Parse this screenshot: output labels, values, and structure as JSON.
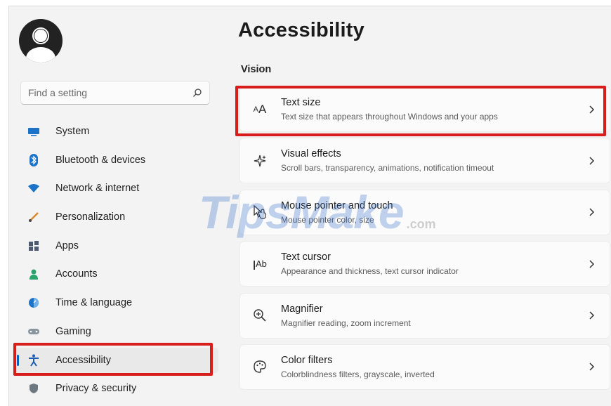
{
  "search": {
    "placeholder": "Find a setting"
  },
  "sidebar": {
    "items": [
      {
        "label": "System",
        "icon": "monitor-icon"
      },
      {
        "label": "Bluetooth & devices",
        "icon": "bluetooth-icon"
      },
      {
        "label": "Network & internet",
        "icon": "wifi-icon"
      },
      {
        "label": "Personalization",
        "icon": "brush-icon"
      },
      {
        "label": "Apps",
        "icon": "apps-icon"
      },
      {
        "label": "Accounts",
        "icon": "person-icon"
      },
      {
        "label": "Time & language",
        "icon": "globe-clock-icon"
      },
      {
        "label": "Gaming",
        "icon": "gamepad-icon"
      },
      {
        "label": "Accessibility",
        "icon": "accessibility-icon"
      },
      {
        "label": "Privacy & security",
        "icon": "shield-icon"
      }
    ],
    "active_index": 8
  },
  "main": {
    "title": "Accessibility",
    "section": "Vision",
    "cards": [
      {
        "title": "Text size",
        "subtitle": "Text size that appears throughout Windows and your apps",
        "icon": "text-size-icon",
        "glyph": "AA"
      },
      {
        "title": "Visual effects",
        "subtitle": "Scroll bars, transparency, animations, notification timeout",
        "icon": "sparkle-icon"
      },
      {
        "title": "Mouse pointer and touch",
        "subtitle": "Mouse pointer color, size",
        "icon": "mouse-pointer-icon"
      },
      {
        "title": "Text cursor",
        "subtitle": "Appearance and thickness, text cursor indicator",
        "icon": "text-cursor-icon",
        "glyph": "|Ab"
      },
      {
        "title": "Magnifier",
        "subtitle": "Magnifier reading, zoom increment",
        "icon": "magnifier-icon"
      },
      {
        "title": "Color filters",
        "subtitle": "Colorblindness filters, grayscale, inverted",
        "icon": "palette-icon"
      }
    ]
  },
  "watermark": {
    "text": "TipsMake",
    "suffix": ".com"
  },
  "colors": {
    "accent": "#0067c0",
    "highlight": "#d81d1d",
    "background": "#f3f3f3",
    "card": "#fbfbfb"
  }
}
